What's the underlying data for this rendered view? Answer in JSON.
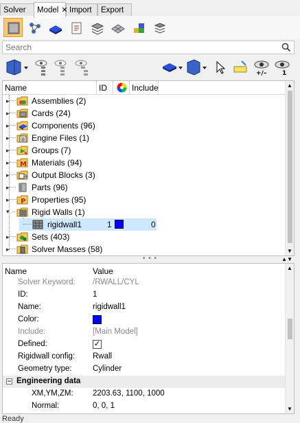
{
  "tabs": [
    {
      "label": "Solver"
    },
    {
      "label": "Model"
    },
    {
      "label": "Import"
    },
    {
      "label": "Export"
    }
  ],
  "toolbar1_icons": [
    "model-browser-icon",
    "connectivity-icon",
    "entity-box-icon",
    "card-edit-icon",
    "solver-deck-icon",
    "mesh-icon",
    "layers-icon",
    "stack-icon"
  ],
  "search": {
    "placeholder": "Search",
    "value": ""
  },
  "tree": {
    "columns": {
      "name": "Name",
      "id": "ID",
      "include": "Include"
    },
    "items": [
      {
        "label": "Assemblies (2)",
        "icon": "assemblies-icon"
      },
      {
        "label": "Cards (24)",
        "icon": "cards-icon"
      },
      {
        "label": "Components (96)",
        "icon": "components-icon"
      },
      {
        "label": "Engine Files (1)",
        "icon": "engine-files-icon"
      },
      {
        "label": "Groups (7)",
        "icon": "groups-icon"
      },
      {
        "label": "Materials (94)",
        "icon": "materials-icon"
      },
      {
        "label": "Output Blocks (3)",
        "icon": "output-blocks-icon"
      },
      {
        "label": "Parts (96)",
        "icon": "parts-icon"
      },
      {
        "label": "Properties (95)",
        "icon": "properties-icon"
      },
      {
        "label": "Rigid Walls (1)",
        "icon": "rigid-walls-icon"
      },
      {
        "label": "Sets (403)",
        "icon": "sets-icon"
      },
      {
        "label": "Solver Masses (58)",
        "icon": "solver-masses-icon"
      }
    ],
    "child": {
      "label": "rigidwall1",
      "id": "1",
      "include": "0",
      "color": "#0000ff"
    }
  },
  "props": {
    "header_name": "Name",
    "header_value": "Value",
    "rows": [
      {
        "name": "Solver Keyword:",
        "value": "/RWALL/CYL"
      },
      {
        "name": "ID:",
        "value": "1"
      },
      {
        "name": "Name:",
        "value": "rigidwall1"
      },
      {
        "name": "Color:",
        "value": ""
      },
      {
        "name": "Include:",
        "value": "[Main Model]"
      },
      {
        "name": "Defined:",
        "value": ""
      },
      {
        "name": "Rigidwall config:",
        "value": "Rwall"
      },
      {
        "name": "Geometry type:",
        "value": "Cylinder"
      },
      {
        "name": "Engineering data",
        "value": ""
      },
      {
        "name": "XM,YM,ZM:",
        "value": "2203.63, 1100, 1000"
      },
      {
        "name": "Normal:",
        "value": "0, 0, 1"
      }
    ],
    "color_value": "#0000ff",
    "defined_checked": true
  },
  "status": {
    "text": "Ready"
  },
  "colors": {
    "accent": "#fbc877",
    "selection": "#cde8ff"
  }
}
